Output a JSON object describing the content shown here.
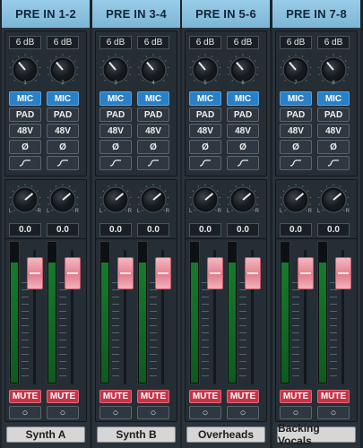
{
  "strips": [
    {
      "header": "PRE IN 1-2",
      "name": "Synth A",
      "gain": [
        "6 dB",
        "6 dB"
      ],
      "knob_nums": [
        "1",
        "2"
      ],
      "mic": [
        "MIC",
        "MIC"
      ],
      "pad": [
        "PAD",
        "PAD"
      ],
      "phantom": [
        "48V",
        "48V"
      ],
      "pan": [
        "0.0",
        "0.0"
      ],
      "mute": [
        "MUTE",
        "MUTE"
      ]
    },
    {
      "header": "PRE IN 3-4",
      "name": "Synth B",
      "gain": [
        "6 dB",
        "6 dB"
      ],
      "knob_nums": [
        "3",
        "4"
      ],
      "mic": [
        "MIC",
        "MIC"
      ],
      "pad": [
        "PAD",
        "PAD"
      ],
      "phantom": [
        "48V",
        "48V"
      ],
      "pan": [
        "0.0",
        "0.0"
      ],
      "mute": [
        "MUTE",
        "MUTE"
      ]
    },
    {
      "header": "PRE IN 5-6",
      "name": "Overheads",
      "gain": [
        "6 dB",
        "6 dB"
      ],
      "knob_nums": [
        "5",
        "6"
      ],
      "mic": [
        "MIC",
        "MIC"
      ],
      "pad": [
        "PAD",
        "PAD"
      ],
      "phantom": [
        "48V",
        "48V"
      ],
      "pan": [
        "0.0",
        "0.0"
      ],
      "mute": [
        "MUTE",
        "MUTE"
      ]
    },
    {
      "header": "PRE IN 7-8",
      "name": "Backing Vocals",
      "gain": [
        "6 dB",
        "6 dB"
      ],
      "knob_nums": [
        "7",
        "8"
      ],
      "mic": [
        "MIC",
        "MIC"
      ],
      "pad": [
        "PAD",
        "PAD"
      ],
      "phantom": [
        "48V",
        "48V"
      ],
      "pan": [
        "0.0",
        "0.0"
      ],
      "mute": [
        "MUTE",
        "MUTE"
      ]
    }
  ],
  "pan_labels": {
    "left": "L",
    "right": "R"
  },
  "phase_symbol": "Ø",
  "solo_symbol": "○",
  "icons": {
    "hpf": "high-pass-filter-icon",
    "phase": "phase-invert-icon",
    "solo": "solo-circle-icon"
  },
  "meter_level": 0.85,
  "colors": {
    "header_bg": "#8cc2e0",
    "mic_active": "#2a80c6",
    "mute": "#c23549",
    "fader_cap": "#f2a9b4",
    "meter_green": "#177a2c"
  }
}
